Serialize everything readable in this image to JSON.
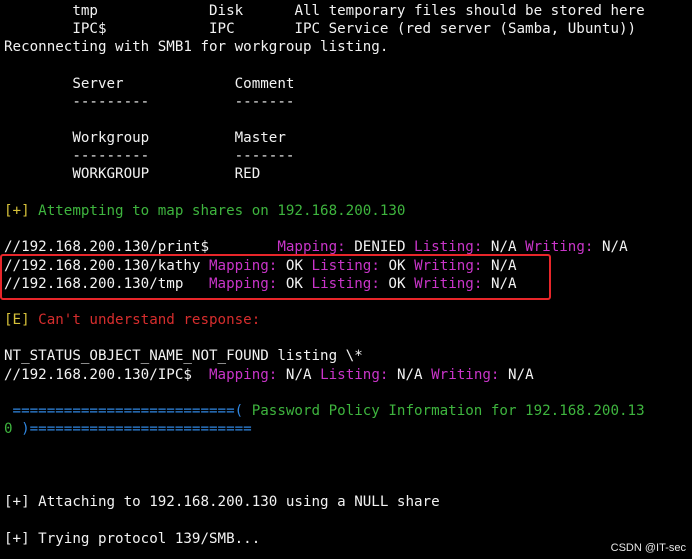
{
  "share_rows": [
    {
      "name": "tmp",
      "type": "Disk",
      "comment": "All temporary files should be stored here"
    },
    {
      "name": "IPC$",
      "type": "IPC",
      "comment": "IPC Service (red server (Samba, Ubuntu))"
    }
  ],
  "reconnect_msg": "Reconnecting with SMB1 for workgroup listing.",
  "server_table": {
    "col1": "Server",
    "col2": "Comment",
    "sep1": "---------",
    "sep2": "-------"
  },
  "workgroup_table": {
    "col1": "Workgroup",
    "col2": "Master",
    "sep1": "---------",
    "sep2": "-------",
    "value1": "WORKGROUP",
    "value2": "RED"
  },
  "attempt": {
    "tag": "[+]",
    "text": "Attempting to map shares on 192.168.200.130"
  },
  "map_rows": [
    {
      "path": "//192.168.200.130/print$",
      "pad": "        ",
      "mapping_label": "Mapping:",
      "mapping": "DENIED",
      "listing_label": "Listing:",
      "listing": "N/A",
      "writing_label": "Writing:",
      "writing": "N/A"
    },
    {
      "path": "//192.168.200.130/kathy",
      "pad": " ",
      "mapping_label": "Mapping:",
      "mapping": "OK",
      "listing_label": "Listing:",
      "listing": "OK",
      "writing_label": "Writing:",
      "writing": "N/A"
    },
    {
      "path": "//192.168.200.130/tmp",
      "pad": "   ",
      "mapping_label": "Mapping:",
      "mapping": "OK",
      "listing_label": "Listing:",
      "listing": "OK",
      "writing_label": "Writing:",
      "writing": "N/A"
    }
  ],
  "error": {
    "tag": "[E]",
    "text": "Can't understand response:"
  },
  "status_line": "NT_STATUS_OBJECT_NAME_NOT_FOUND listing \\*",
  "ipc_row": {
    "path": "//192.168.200.130/IPC$",
    "pad": "  ",
    "mapping_label": "Mapping:",
    "mapping": "N/A",
    "listing_label": "Listing:",
    "listing": "N/A",
    "writing_label": "Writing:",
    "writing": "N/A"
  },
  "policy": {
    "left_rule": " ==========================(",
    "title": " Password Policy Information for 192.168.200.13",
    "wrap_digit": "0",
    "right_rule": " )=========================="
  },
  "attach_line": "[+] Attaching to 192.168.200.130 using a NULL share",
  "trying_line": "[+] Trying protocol 139/SMB...",
  "watermark": "CSDN @IT-sec",
  "colors": {
    "background": "#000000",
    "text": "#f2f2f2",
    "label_magenta": "#c935c9",
    "info_green": "#3eb43e",
    "tag_yellow": "#d7c23a",
    "error_red": "#d62d2d",
    "rule_blue": "#2f86e0",
    "highlight_box": "#e8262a"
  }
}
